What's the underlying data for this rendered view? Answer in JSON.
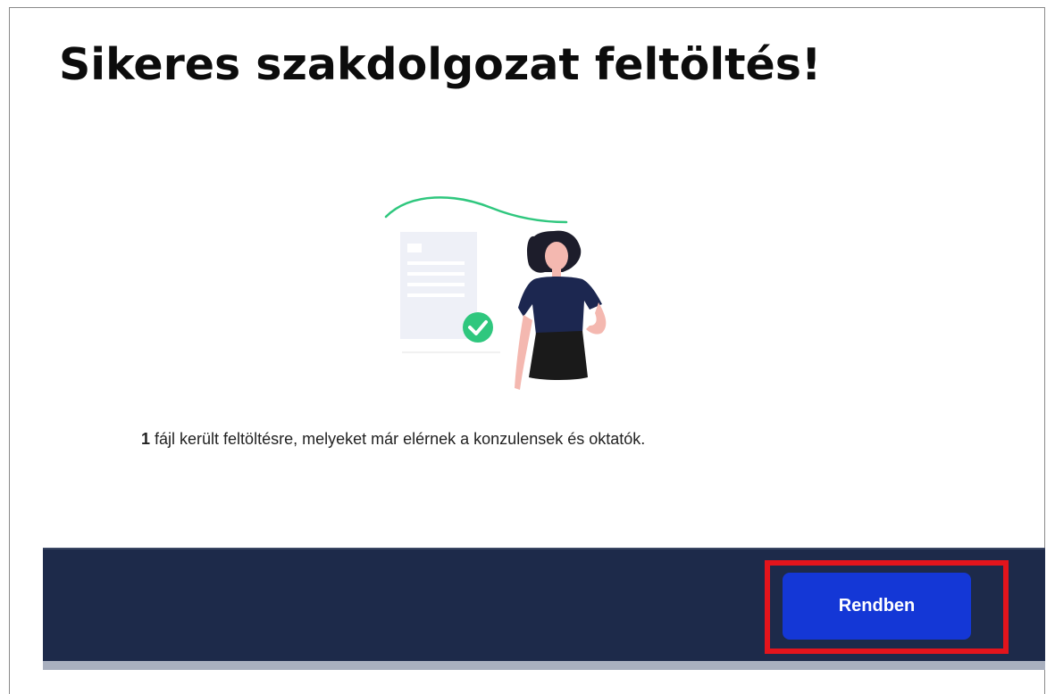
{
  "dialog": {
    "title": "Sikeres szakdolgozat feltöltés!",
    "message_count": "1",
    "message_text": " fájl került feltöltésre, melyeket már elérnek a konzulensek és oktatók.",
    "illustration": "woman-with-uploaded-document-checkmark"
  },
  "footer": {
    "ok_label": "Rendben",
    "highlight_color": "#e3141c"
  },
  "colors": {
    "footer_bg": "#1d2a4a",
    "button_bg": "#1437d6",
    "check_green": "#2fc77e"
  }
}
